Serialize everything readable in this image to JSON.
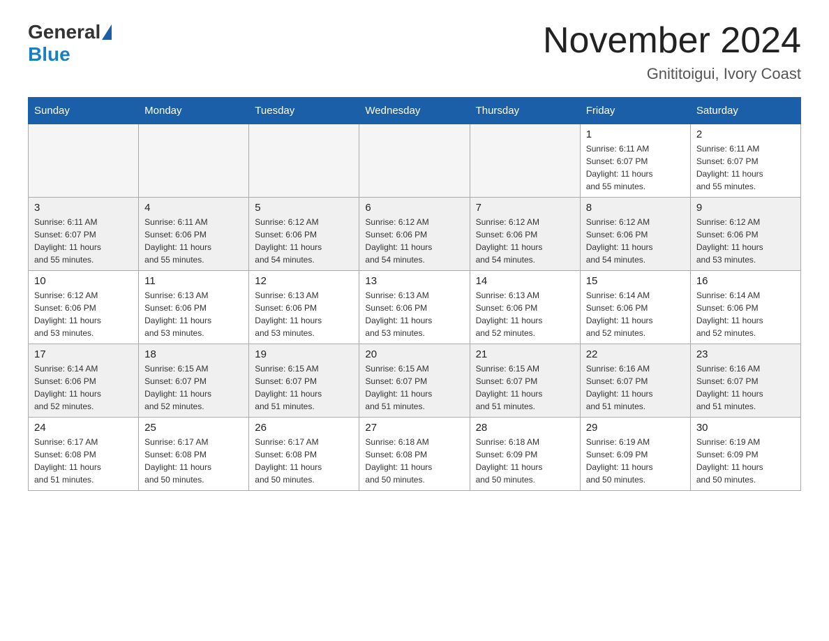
{
  "header": {
    "logo_general": "General",
    "logo_blue": "Blue",
    "month_title": "November 2024",
    "location": "Gnititoigui, Ivory Coast"
  },
  "weekdays": [
    "Sunday",
    "Monday",
    "Tuesday",
    "Wednesday",
    "Thursday",
    "Friday",
    "Saturday"
  ],
  "weeks": [
    [
      {
        "day": "",
        "info": ""
      },
      {
        "day": "",
        "info": ""
      },
      {
        "day": "",
        "info": ""
      },
      {
        "day": "",
        "info": ""
      },
      {
        "day": "",
        "info": ""
      },
      {
        "day": "1",
        "info": "Sunrise: 6:11 AM\nSunset: 6:07 PM\nDaylight: 11 hours\nand 55 minutes."
      },
      {
        "day": "2",
        "info": "Sunrise: 6:11 AM\nSunset: 6:07 PM\nDaylight: 11 hours\nand 55 minutes."
      }
    ],
    [
      {
        "day": "3",
        "info": "Sunrise: 6:11 AM\nSunset: 6:07 PM\nDaylight: 11 hours\nand 55 minutes."
      },
      {
        "day": "4",
        "info": "Sunrise: 6:11 AM\nSunset: 6:06 PM\nDaylight: 11 hours\nand 55 minutes."
      },
      {
        "day": "5",
        "info": "Sunrise: 6:12 AM\nSunset: 6:06 PM\nDaylight: 11 hours\nand 54 minutes."
      },
      {
        "day": "6",
        "info": "Sunrise: 6:12 AM\nSunset: 6:06 PM\nDaylight: 11 hours\nand 54 minutes."
      },
      {
        "day": "7",
        "info": "Sunrise: 6:12 AM\nSunset: 6:06 PM\nDaylight: 11 hours\nand 54 minutes."
      },
      {
        "day": "8",
        "info": "Sunrise: 6:12 AM\nSunset: 6:06 PM\nDaylight: 11 hours\nand 54 minutes."
      },
      {
        "day": "9",
        "info": "Sunrise: 6:12 AM\nSunset: 6:06 PM\nDaylight: 11 hours\nand 53 minutes."
      }
    ],
    [
      {
        "day": "10",
        "info": "Sunrise: 6:12 AM\nSunset: 6:06 PM\nDaylight: 11 hours\nand 53 minutes."
      },
      {
        "day": "11",
        "info": "Sunrise: 6:13 AM\nSunset: 6:06 PM\nDaylight: 11 hours\nand 53 minutes."
      },
      {
        "day": "12",
        "info": "Sunrise: 6:13 AM\nSunset: 6:06 PM\nDaylight: 11 hours\nand 53 minutes."
      },
      {
        "day": "13",
        "info": "Sunrise: 6:13 AM\nSunset: 6:06 PM\nDaylight: 11 hours\nand 53 minutes."
      },
      {
        "day": "14",
        "info": "Sunrise: 6:13 AM\nSunset: 6:06 PM\nDaylight: 11 hours\nand 52 minutes."
      },
      {
        "day": "15",
        "info": "Sunrise: 6:14 AM\nSunset: 6:06 PM\nDaylight: 11 hours\nand 52 minutes."
      },
      {
        "day": "16",
        "info": "Sunrise: 6:14 AM\nSunset: 6:06 PM\nDaylight: 11 hours\nand 52 minutes."
      }
    ],
    [
      {
        "day": "17",
        "info": "Sunrise: 6:14 AM\nSunset: 6:06 PM\nDaylight: 11 hours\nand 52 minutes."
      },
      {
        "day": "18",
        "info": "Sunrise: 6:15 AM\nSunset: 6:07 PM\nDaylight: 11 hours\nand 52 minutes."
      },
      {
        "day": "19",
        "info": "Sunrise: 6:15 AM\nSunset: 6:07 PM\nDaylight: 11 hours\nand 51 minutes."
      },
      {
        "day": "20",
        "info": "Sunrise: 6:15 AM\nSunset: 6:07 PM\nDaylight: 11 hours\nand 51 minutes."
      },
      {
        "day": "21",
        "info": "Sunrise: 6:15 AM\nSunset: 6:07 PM\nDaylight: 11 hours\nand 51 minutes."
      },
      {
        "day": "22",
        "info": "Sunrise: 6:16 AM\nSunset: 6:07 PM\nDaylight: 11 hours\nand 51 minutes."
      },
      {
        "day": "23",
        "info": "Sunrise: 6:16 AM\nSunset: 6:07 PM\nDaylight: 11 hours\nand 51 minutes."
      }
    ],
    [
      {
        "day": "24",
        "info": "Sunrise: 6:17 AM\nSunset: 6:08 PM\nDaylight: 11 hours\nand 51 minutes."
      },
      {
        "day": "25",
        "info": "Sunrise: 6:17 AM\nSunset: 6:08 PM\nDaylight: 11 hours\nand 50 minutes."
      },
      {
        "day": "26",
        "info": "Sunrise: 6:17 AM\nSunset: 6:08 PM\nDaylight: 11 hours\nand 50 minutes."
      },
      {
        "day": "27",
        "info": "Sunrise: 6:18 AM\nSunset: 6:08 PM\nDaylight: 11 hours\nand 50 minutes."
      },
      {
        "day": "28",
        "info": "Sunrise: 6:18 AM\nSunset: 6:09 PM\nDaylight: 11 hours\nand 50 minutes."
      },
      {
        "day": "29",
        "info": "Sunrise: 6:19 AM\nSunset: 6:09 PM\nDaylight: 11 hours\nand 50 minutes."
      },
      {
        "day": "30",
        "info": "Sunrise: 6:19 AM\nSunset: 6:09 PM\nDaylight: 11 hours\nand 50 minutes."
      }
    ]
  ]
}
